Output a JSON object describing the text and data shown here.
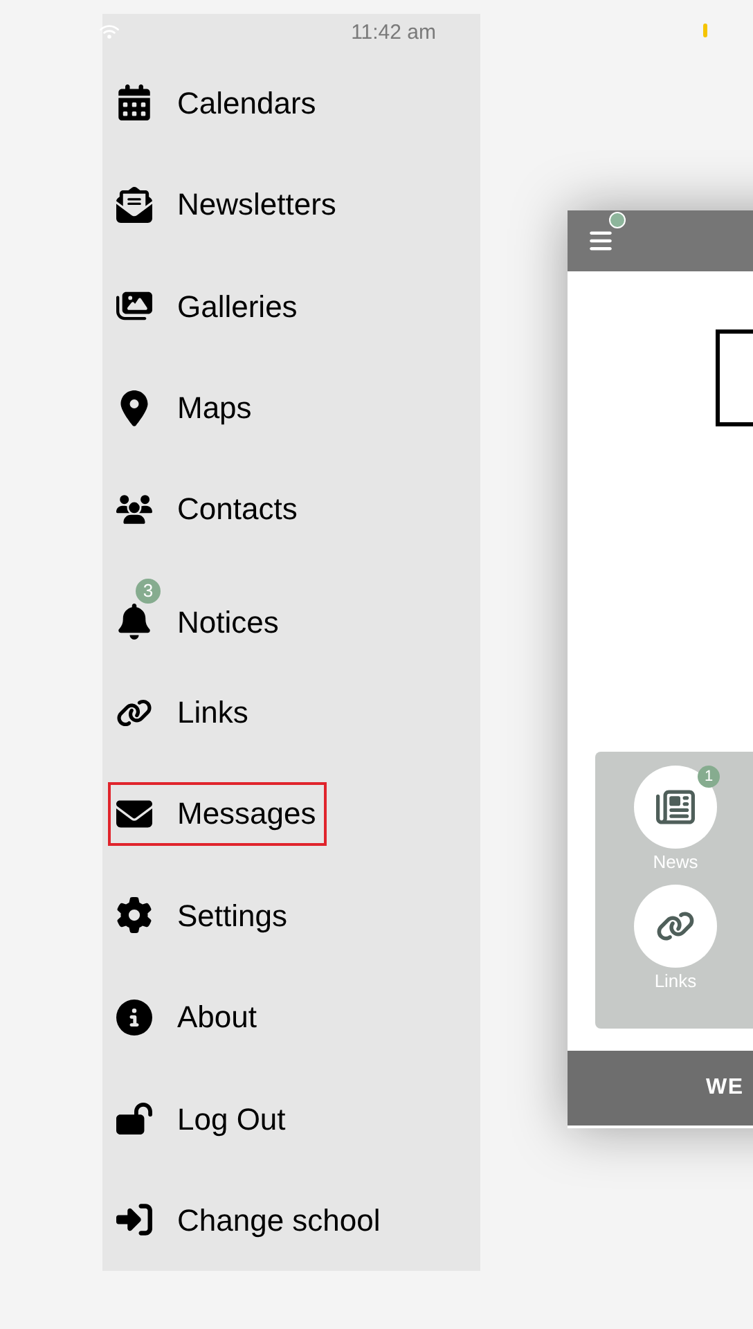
{
  "status_bar": {
    "time": "11:42 am"
  },
  "drawer": {
    "items": [
      {
        "label": "Calendars",
        "highlighted": false
      },
      {
        "label": "Newsletters",
        "highlighted": false
      },
      {
        "label": "Galleries",
        "highlighted": false
      },
      {
        "label": "Maps",
        "highlighted": false
      },
      {
        "label": "Contacts",
        "highlighted": false
      },
      {
        "label": "Notices",
        "highlighted": false,
        "badge": "3"
      },
      {
        "label": "Links",
        "highlighted": false
      },
      {
        "label": "Messages",
        "highlighted": true
      },
      {
        "label": "Settings",
        "highlighted": false
      },
      {
        "label": "About",
        "highlighted": false
      },
      {
        "label": "Log Out",
        "highlighted": false
      },
      {
        "label": "Change school",
        "highlighted": false
      }
    ]
  },
  "app_preview": {
    "tiles": [
      {
        "label": "News",
        "badge": "1"
      },
      {
        "label": "Links"
      }
    ],
    "footer": "WE"
  }
}
